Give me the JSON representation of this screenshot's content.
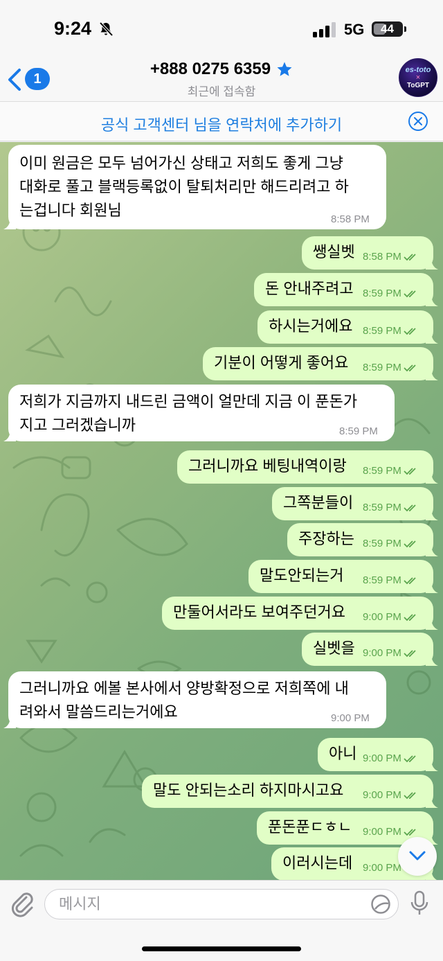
{
  "status_bar": {
    "time": "9:24",
    "network": "5G",
    "battery": "44",
    "battery_level": 0.44
  },
  "header": {
    "back_count": "1",
    "contact_name": "+888 0275 6359",
    "last_seen": "최근에 접속함",
    "avatar_line1": "es-toto",
    "avatar_line2": "×",
    "avatar_line3": "ToGPT"
  },
  "banner": {
    "text": "공식 고객센터 님을 연락처에 추가하기"
  },
  "messages": [
    {
      "dir": "in",
      "lines": [
        "이미 원금은 모두 넘어가신 상태고 저희도 좋게 그냥",
        "대화로 풀고 블랙등록없이 탈퇴처리만 해드리려고 하",
        "는겁니다 회원님"
      ],
      "time": "8:58 PM"
    },
    {
      "dir": "out",
      "lines": [
        "쌩실벳"
      ],
      "time": "8:58 PM"
    },
    {
      "dir": "out",
      "lines": [
        "돈 안내주려고"
      ],
      "time": "8:59 PM"
    },
    {
      "dir": "out",
      "lines": [
        "하시는거에요"
      ],
      "time": "8:59 PM"
    },
    {
      "dir": "out",
      "lines": [
        "기분이 어떻게 좋어요"
      ],
      "time": "8:59 PM"
    },
    {
      "dir": "in",
      "lines": [
        "저희가 지금까지 내드린 금액이 얼만데 지금 이 푼돈가",
        "지고 그러겠습니까"
      ],
      "time": "8:59 PM"
    },
    {
      "dir": "out",
      "lines": [
        "그러니까요 베팅내역이랑"
      ],
      "time": "8:59 PM"
    },
    {
      "dir": "out",
      "lines": [
        "그쪽분들이"
      ],
      "time": "8:59 PM"
    },
    {
      "dir": "out",
      "lines": [
        "주장하는"
      ],
      "time": "8:59 PM"
    },
    {
      "dir": "out",
      "lines": [
        "말도안되는거"
      ],
      "time": "8:59 PM"
    },
    {
      "dir": "out",
      "lines": [
        "만둘어서라도 보여주던거요"
      ],
      "time": "9:00 PM"
    },
    {
      "dir": "out",
      "lines": [
        "실벳을"
      ],
      "time": "9:00 PM"
    },
    {
      "dir": "in",
      "lines": [
        "그러니까요 에볼 본사에서 양방확정으로 저희쪽에 내",
        "려와서 말씀드리는거에요"
      ],
      "time": "9:00 PM"
    },
    {
      "dir": "out",
      "lines": [
        "아니"
      ],
      "time": "9:00 PM"
    },
    {
      "dir": "out",
      "lines": [
        "말도 안되는소리 하지마시고요"
      ],
      "time": "9:00 PM"
    },
    {
      "dir": "out",
      "lines": [
        "푼돈푼ㄷㅎㄴ"
      ],
      "time": "9:00 PM"
    },
    {
      "dir": "out",
      "lines": [
        "이러시는데"
      ],
      "time": "9:00 PM"
    }
  ],
  "input": {
    "placeholder": "메시지"
  },
  "colors": {
    "incoming_bubble": "#ffffff",
    "outgoing_bubble": "#e1fec6",
    "accent": "#1a7ae8",
    "read_check": "#5aa44d"
  }
}
